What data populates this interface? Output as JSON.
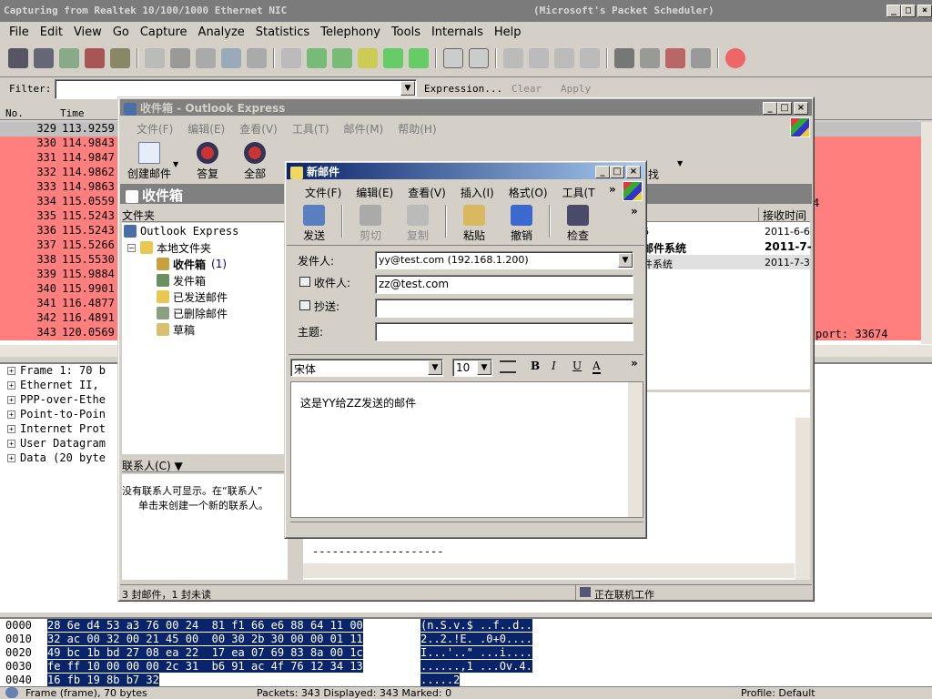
{
  "ws": {
    "title": "Capturing from Realtek 10/100/1000 Ethernet NIC",
    "title_right": "(Microsoft's Packet Scheduler)",
    "menu": [
      "File",
      "Edit",
      "View",
      "Go",
      "Capture",
      "Analyze",
      "Statistics",
      "Telephony",
      "Tools",
      "Internals",
      "Help"
    ],
    "filter_label": "Filter:",
    "filter_value": "",
    "expression": "Expression...",
    "clear": "Clear",
    "apply": "Apply",
    "col_no": "No.",
    "col_time": "Time",
    "packets": [
      {
        "no": "329",
        "time": "113.9259"
      },
      {
        "no": "330",
        "time": "114.9843"
      },
      {
        "no": "331",
        "time": "114.9847"
      },
      {
        "no": "332",
        "time": "114.9862"
      },
      {
        "no": "333",
        "time": "114.9863"
      },
      {
        "no": "334",
        "time": "115.0559"
      },
      {
        "no": "335",
        "time": "115.5243"
      },
      {
        "no": "336",
        "time": "115.5243"
      },
      {
        "no": "337",
        "time": "115.5266"
      },
      {
        "no": "338",
        "time": "115.5530"
      },
      {
        "no": "339",
        "time": "115.9884"
      },
      {
        "no": "340",
        "time": "115.9901"
      },
      {
        "no": "341",
        "time": "116.4877"
      },
      {
        "no": "342",
        "time": "116.4891"
      },
      {
        "no": "343",
        "time": "120.0569"
      }
    ],
    "port_fragment": "port: 33674",
    "row_334_tail": "4",
    "details": [
      "Frame 1: 70 b",
      "Ethernet II,",
      "PPP-over-Ethe",
      "Point-to-Poin",
      "Internet Prot",
      "User Datagram",
      "Data (20 byte"
    ],
    "hex": [
      {
        "off": "0000",
        "bytes": "28 6e d4 53 a3 76 00 24  81 f1 66 e6 88 64 11 00",
        "ascii": "(n.S.v.$ ..f..d.."
      },
      {
        "off": "0010",
        "bytes": "32 ac 00 32 00 21 45 00  00 30 2b 30 00 00 01 11",
        "ascii": "2..2.!E. .0+0...."
      },
      {
        "off": "0020",
        "bytes": "49 bc 1b bd 27 08 ea 22  17 ea 07 69 83 8a 00 1c",
        "ascii": "I...'..\" ...i...."
      },
      {
        "off": "0030",
        "bytes": "fe ff 10 00 00 00 2c 31  b6 91 ac 4f 76 12 34 13",
        "ascii": "......,1 ...Ov.4."
      },
      {
        "off": "0040",
        "bytes": "16 fb 19 8b b7 32",
        "ascii": ".....2"
      }
    ],
    "status_frame": "Frame (frame), 70 bytes",
    "status_packets": "Packets: 343 Displayed: 343 Marked: 0",
    "status_profile": "Profile: Default"
  },
  "oe": {
    "title": "收件箱 - Outlook Express",
    "menu": [
      "文件(F)",
      "编辑(E)",
      "查看(V)",
      "工具(T)",
      "邮件(M)",
      "帮助(H)"
    ],
    "toolbar": [
      "创建邮件",
      "答复",
      "全部"
    ],
    "toolbar_right": "找",
    "inbox_header": "收件箱",
    "folders_header": "文件夹",
    "folders": {
      "root": "Outlook Express",
      "local": "本地文件夹",
      "inbox": "收件箱",
      "inbox_count": "(1)",
      "outbox": "发件箱",
      "sent": "已发送邮件",
      "deleted": "已删除邮件",
      "drafts": "草稿"
    },
    "contacts_header": "联系人(C) ▼",
    "contacts_text_1": "没有联系人可显示。在“联系人”",
    "contacts_text_2": "单击来创建一个新的联系人。",
    "received_header": "接收时间",
    "msg_rows": [
      {
        "from": "6",
        "date": "2011-6-6"
      },
      {
        "from": "邮件系统",
        "date": "2011-7-"
      },
      {
        "from": "件系统",
        "date": "2011-7-3"
      }
    ],
    "preview_dashes": "--------------------",
    "status_left": "3 封邮件，1 封未读",
    "status_right": "正在联机工作"
  },
  "nm": {
    "title": "新邮件",
    "menu": [
      "文件(F)",
      "编辑(E)",
      "查看(V)",
      "插入(I)",
      "格式(O)",
      "工具(T"
    ],
    "toolbar": [
      {
        "label": "发送",
        "enabled": true
      },
      {
        "label": "剪切",
        "enabled": false
      },
      {
        "label": "复制",
        "enabled": false
      },
      {
        "label": "粘贴",
        "enabled": true
      },
      {
        "label": "撤销",
        "enabled": true
      },
      {
        "label": "检查",
        "enabled": true
      }
    ],
    "from_label": "发件人:",
    "from_value": "yy@test.com   (192.168.1.200)",
    "to_label": "收件人:",
    "to_value": "zz@test.com",
    "cc_label": "抄送:",
    "cc_value": "",
    "subject_label": "主题:",
    "subject_value": "",
    "font_name": "宋体",
    "font_size": "10",
    "fmt_bold": "B",
    "fmt_italic": "I",
    "fmt_underline": "U",
    "fmt_color": "A",
    "more": "»",
    "body": "这是YY给ZZ发送的邮件"
  }
}
